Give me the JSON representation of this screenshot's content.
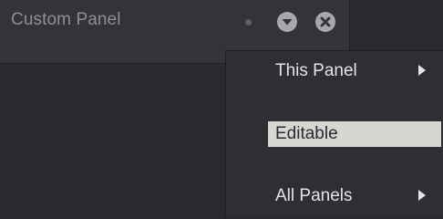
{
  "panel": {
    "title": "Custom Panel",
    "icons": {
      "modified": "modified-dot",
      "menu": "chevron-down-circle-icon",
      "close": "close-circle-icon"
    }
  },
  "context_menu": {
    "items": [
      {
        "label": "This Panel",
        "has_submenu": true,
        "highlighted": false
      },
      {
        "label": "Editable",
        "has_submenu": false,
        "highlighted": true
      },
      {
        "label": "All Panels",
        "has_submenu": true,
        "highlighted": false
      }
    ]
  },
  "colors": {
    "background": "#2a292d",
    "panel_header": "#343337",
    "highlight": "#d6d6d2",
    "text": "#e4e3e6",
    "muted_text": "#8f8e93"
  }
}
